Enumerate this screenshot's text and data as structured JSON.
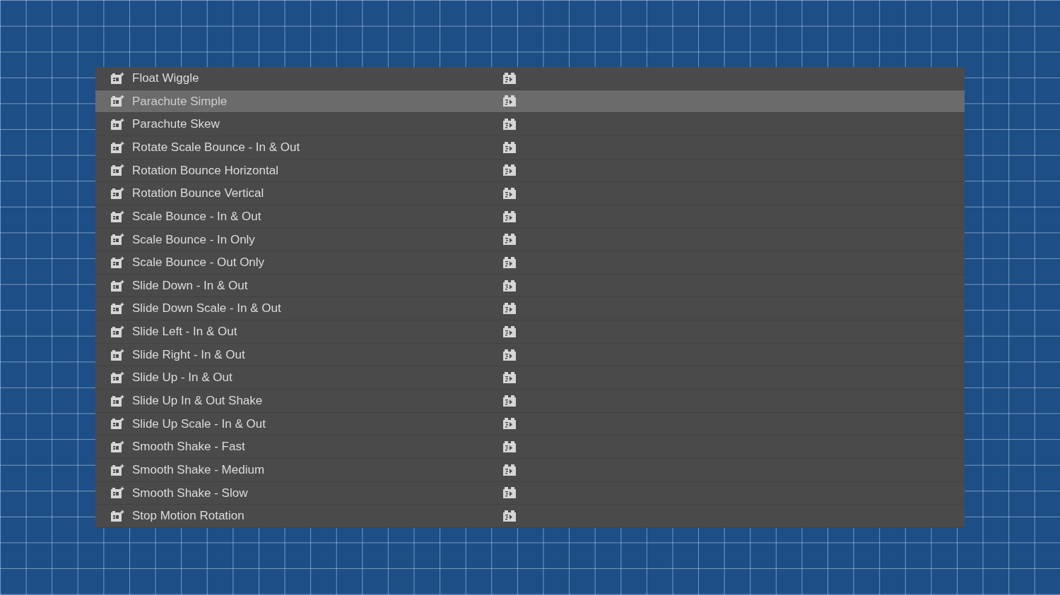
{
  "presets": [
    {
      "name": "Float Wiggle",
      "selected": false
    },
    {
      "name": "Parachute Simple",
      "selected": true
    },
    {
      "name": "Parachute Skew",
      "selected": false
    },
    {
      "name": "Rotate Scale Bounce - In & Out",
      "selected": false
    },
    {
      "name": "Rotation Bounce Horizontal",
      "selected": false
    },
    {
      "name": "Rotation Bounce Vertical",
      "selected": false
    },
    {
      "name": "Scale Bounce - In & Out",
      "selected": false
    },
    {
      "name": "Scale Bounce - In Only",
      "selected": false
    },
    {
      "name": "Scale Bounce - Out Only",
      "selected": false
    },
    {
      "name": "Slide Down - In & Out",
      "selected": false
    },
    {
      "name": "Slide Down Scale - In & Out",
      "selected": false
    },
    {
      "name": "Slide Left - In & Out",
      "selected": false
    },
    {
      "name": "Slide Right - In & Out",
      "selected": false
    },
    {
      "name": "Slide Up - In & Out",
      "selected": false
    },
    {
      "name": "Slide Up In & Out Shake",
      "selected": false
    },
    {
      "name": "Slide Up Scale - In & Out",
      "selected": false
    },
    {
      "name": "Smooth Shake - Fast",
      "selected": false
    },
    {
      "name": "Smooth Shake - Medium",
      "selected": false
    },
    {
      "name": "Smooth Shake - Slow",
      "selected": false
    },
    {
      "name": "Stop Motion Rotation",
      "selected": false
    }
  ]
}
